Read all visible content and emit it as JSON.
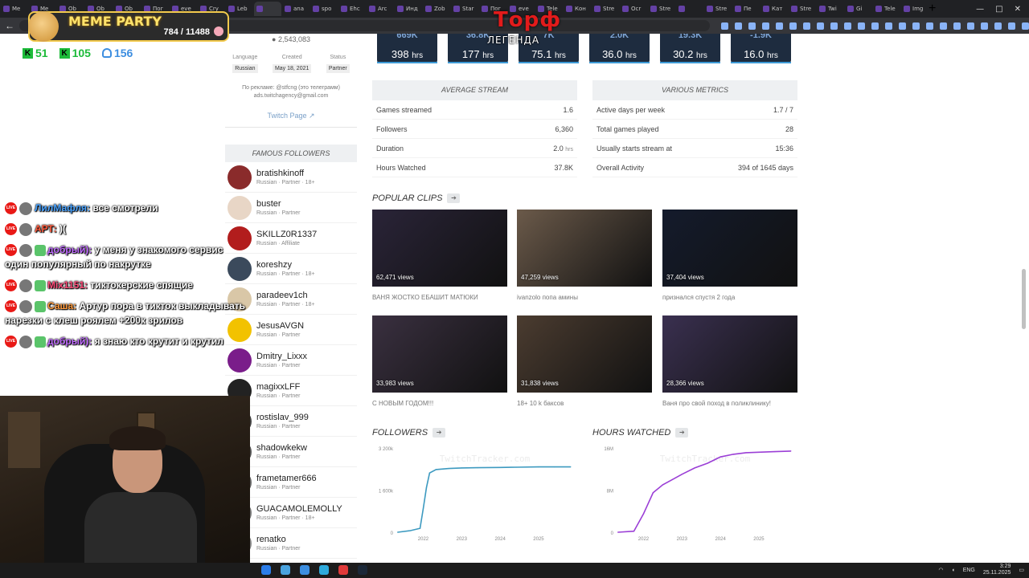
{
  "browser": {
    "tabs": [
      "Me",
      "Me",
      "Ob",
      "Ob",
      "Ob",
      "Пог",
      "eve",
      "Cry",
      "Leb",
      "",
      "ana",
      "spo",
      "Ehc",
      "Arc",
      "Инд",
      "Zob",
      "Star",
      "Пог",
      "eve",
      "Tele",
      "Кон",
      "Stre",
      "Ocr",
      "Stre",
      "",
      "Stre",
      "Пе",
      "Кат",
      "Stre",
      "Twi",
      "Gi",
      "Tele",
      "Img"
    ],
    "active_tab_index": 9
  },
  "overlay": {
    "badge_title": "MEME PARTY",
    "badge_count": "784 / 11488",
    "streamer_name": "Торф",
    "streamer_subtitle": "ЛЕГЕНДА",
    "counter_1": "51",
    "counter_2": "105",
    "viewers": "156"
  },
  "chat": [
    {
      "name": "ЛилМафля:",
      "text": " все смотрели",
      "color": "#4aa3ff"
    },
    {
      "name": "АРТ:",
      "text": " )(",
      "color": "#ff5a3c"
    },
    {
      "name": "добрый):",
      "text": " у меня у знакомого сервис один популярный по накрутке",
      "color": "#c06bff"
    },
    {
      "name": "Mix1151:",
      "text": " тиктокерские спящие",
      "color": "#ff4d7a"
    },
    {
      "name": "Саша:",
      "text": " Артур пора в тикток выкладывать нарезки с клеш роялем +200к зрилов",
      "color": "#ff9a3c"
    },
    {
      "name": "добрый):",
      "text": " я знаю кто крутит и крутил",
      "color": "#c06bff"
    }
  ],
  "channel_meta": {
    "subscribers": "2,543,083",
    "language_label": "Language",
    "language": "Russian",
    "created_label": "Created",
    "created": "May 18, 2021",
    "status_label": "Status",
    "status": "Partner",
    "ads_line1": "По рекламе: @stfcng (это телеграмм)",
    "ads_line2": "ads.twitchagency@gmail.com",
    "twitch_link": "Twitch Page"
  },
  "famous_followers": {
    "header": "FAMOUS FOLLOWERS",
    "items": [
      {
        "name": "bratishkinoff",
        "sub": "Russian · Partner · 18+",
        "color": "#8a2b2b"
      },
      {
        "name": "buster",
        "sub": "Russian · Partner",
        "color": "#e8d6c6"
      },
      {
        "name": "SKILLZ0R1337",
        "sub": "Russian · Affiliate",
        "color": "#b21d1d"
      },
      {
        "name": "koreshzy",
        "sub": "Russian · Partner · 18+",
        "color": "#3b4a5c"
      },
      {
        "name": "paradeev1ch",
        "sub": "Russian · Partner · 18+",
        "color": "#d9c7a7"
      },
      {
        "name": "JesusAVGN",
        "sub": "Russian · Partner",
        "color": "#f2c200"
      },
      {
        "name": "Dmitry_Lixxx",
        "sub": "Russian · Partner",
        "color": "#7a1d8a"
      },
      {
        "name": "magixxLFF",
        "sub": "Russian · Partner",
        "color": "#222222"
      },
      {
        "name": "rostislav_999",
        "sub": "Russian · Partner",
        "color": "#444444"
      },
      {
        "name": "shadowkekw",
        "sub": "Russian · Partner",
        "color": "#555555"
      },
      {
        "name": "frametamer666",
        "sub": "Russian · Partner",
        "color": "#666666"
      },
      {
        "name": "GUACAMOLEMOLLY",
        "sub": "Russian · Partner · 18+",
        "color": "#777777"
      },
      {
        "name": "renatko",
        "sub": "Russian · Partner",
        "color": "#888888"
      }
    ]
  },
  "stat_cards": [
    {
      "top": "669K",
      "value": "398",
      "unit": "hrs"
    },
    {
      "top": "36.8K",
      "value": "177",
      "unit": "hrs"
    },
    {
      "top": "7K",
      "value": "75.1",
      "unit": "hrs"
    },
    {
      "top": "2.0K",
      "value": "36.0",
      "unit": "hrs"
    },
    {
      "top": "19.3K",
      "value": "30.2",
      "unit": "hrs"
    },
    {
      "top": "-1.9K",
      "value": "16.0",
      "unit": "hrs"
    }
  ],
  "average_stream": {
    "header": "AVERAGE STREAM",
    "rows": [
      {
        "label": "Games streamed",
        "value": "1.6",
        "unit": ""
      },
      {
        "label": "Followers",
        "value": "6,360",
        "unit": ""
      },
      {
        "label": "Duration",
        "value": "2.0",
        "unit": "hrs"
      },
      {
        "label": "Hours Watched",
        "value": "37.8K",
        "unit": ""
      }
    ]
  },
  "various_metrics": {
    "header": "VARIOUS METRICS",
    "rows": [
      {
        "label": "Active days per week",
        "value": "1.7 / 7",
        "unit": ""
      },
      {
        "label": "Total games played",
        "value": "28",
        "unit": ""
      },
      {
        "label": "Usually starts stream at",
        "value": "15:36",
        "unit": ""
      },
      {
        "label": "Overall Activity",
        "value": "394 of 1645 days",
        "unit": ""
      }
    ]
  },
  "popular_clips": {
    "title": "POPULAR CLIPS",
    "items": [
      {
        "views": "62,471 views",
        "title": "ВАНЯ ЖОСТКО ЕБАШИТ МАТЮКИ",
        "color": "#2a2438"
      },
      {
        "views": "47,259 views",
        "title": "ivanzolo попа амины",
        "color": "#6b5a4a"
      },
      {
        "views": "37,404 views",
        "title": "признался спустя 2 года",
        "color": "#141b2c"
      },
      {
        "views": "33,983 views",
        "title": "С НОВЫМ ГОДОМ!!!",
        "color": "#3a3040"
      },
      {
        "views": "31,838 views",
        "title": "18+ 10 k баксов",
        "color": "#4b3c30"
      },
      {
        "views": "28,366 views",
        "title": "Ваня про свой поход в поликлинику!",
        "color": "#3a3050"
      }
    ]
  },
  "chart_data": [
    {
      "type": "line",
      "title": "FOLLOWERS",
      "x_ticks": [
        "2022",
        "2023",
        "2024",
        "2025"
      ],
      "y_ticks": [
        "3 200k",
        "1 600k",
        "0"
      ],
      "ylim": [
        0,
        3200000
      ],
      "color": "#3d9ac0",
      "watermark": "TwitchTracker.com",
      "x": [
        "2021-05",
        "2021-09",
        "2021-12",
        "2022-01",
        "2022-02",
        "2022-03",
        "2022-05",
        "2022-09",
        "2023-01",
        "2023-06",
        "2024-01",
        "2024-06",
        "2025-01",
        "2025-06",
        "2025-11"
      ],
      "y": [
        0,
        60000,
        150000,
        900000,
        1700000,
        2250000,
        2380000,
        2420000,
        2440000,
        2450000,
        2460000,
        2470000,
        2480000,
        2480000,
        2480000
      ]
    },
    {
      "type": "line",
      "title": "HOURS WATCHED",
      "x_ticks": [
        "2022",
        "2023",
        "2024",
        "2025"
      ],
      "y_ticks": [
        "16M",
        "8M",
        "0"
      ],
      "ylim": [
        0,
        16000000
      ],
      "color": "#9b3fd6",
      "watermark": "TwitchTracker.com",
      "x": [
        "2021-05",
        "2021-10",
        "2022-01",
        "2022-04",
        "2022-07",
        "2022-10",
        "2023-01",
        "2023-05",
        "2023-09",
        "2024-01",
        "2024-05",
        "2024-09",
        "2025-01",
        "2025-06",
        "2025-11"
      ],
      "y": [
        0,
        200000,
        3500000,
        7500000,
        9000000,
        10000000,
        11000000,
        12200000,
        13100000,
        14300000,
        14800000,
        15100000,
        15200000,
        15300000,
        15400000
      ]
    }
  ],
  "taskbar": {
    "lang": "ENG",
    "time": "3:29",
    "date": "25.11.2025"
  }
}
